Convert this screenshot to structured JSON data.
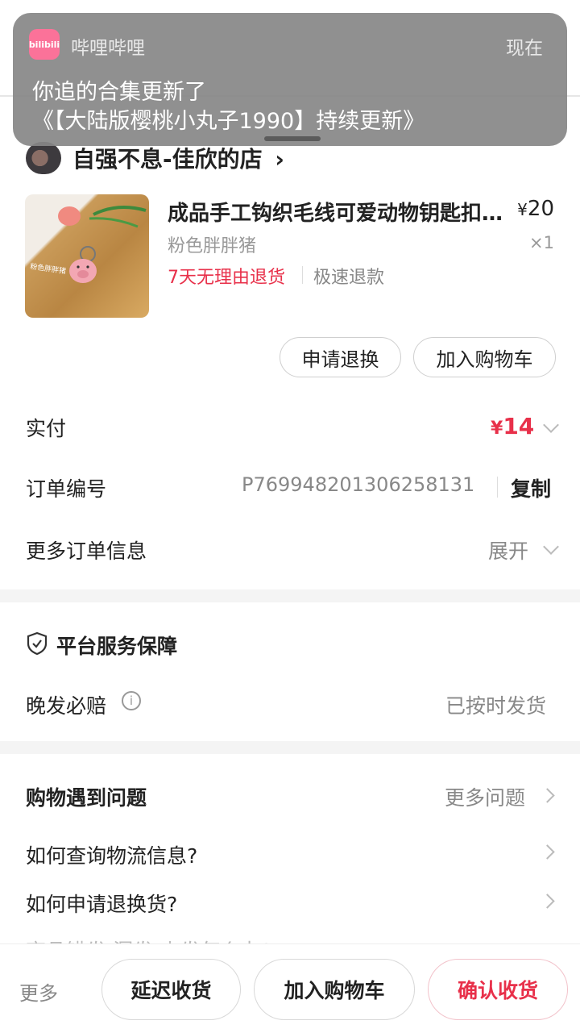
{
  "notification": {
    "app_name": "哔哩哔哩",
    "app_icon_text": "bilibili",
    "time": "现在",
    "title": "你追的合集更新了",
    "body": "《【大陆版樱桃小丸子1990】持续更新》"
  },
  "shop": {
    "name": "自强不息-佳欣的店",
    "chevron": "›"
  },
  "product": {
    "title": "成品手工钩织毛线可爱动物钥匙扣挂件",
    "price_symbol": "¥",
    "price": "20",
    "variant": "粉色胖胖猪",
    "quantity": "×1",
    "tag_return": "7天无理由退货",
    "tag_refund": "极速退款",
    "image_caption": "粉色胖胖猪"
  },
  "product_actions": {
    "refund_label": "申请退换",
    "add_cart_label": "加入购物车"
  },
  "order_info": {
    "paid_label": "实付",
    "paid_symbol": "¥",
    "paid_amount": "14",
    "order_no_label": "订单编号",
    "order_no": "P769948201306258131",
    "copy_label": "复制",
    "more_info_label": "更多订单信息",
    "expand_label": "展开"
  },
  "guarantee": {
    "title": "平台服务保障",
    "item_label": "晚发必赔",
    "item_status": "已按时发货"
  },
  "faq": {
    "title": "购物遇到问题",
    "more_label": "更多问题",
    "items": [
      "如何查询物流信息?",
      "如何申请退换货?",
      "商品错发/漏发/少发怎么办?"
    ]
  },
  "bottom_bar": {
    "more_label": "更多",
    "delay_label": "延迟收货",
    "add_cart_label": "加入购物车",
    "confirm_label": "确认收货"
  },
  "colors": {
    "accent_red": "#e8304a",
    "bilibili_pink": "#fb7299"
  }
}
